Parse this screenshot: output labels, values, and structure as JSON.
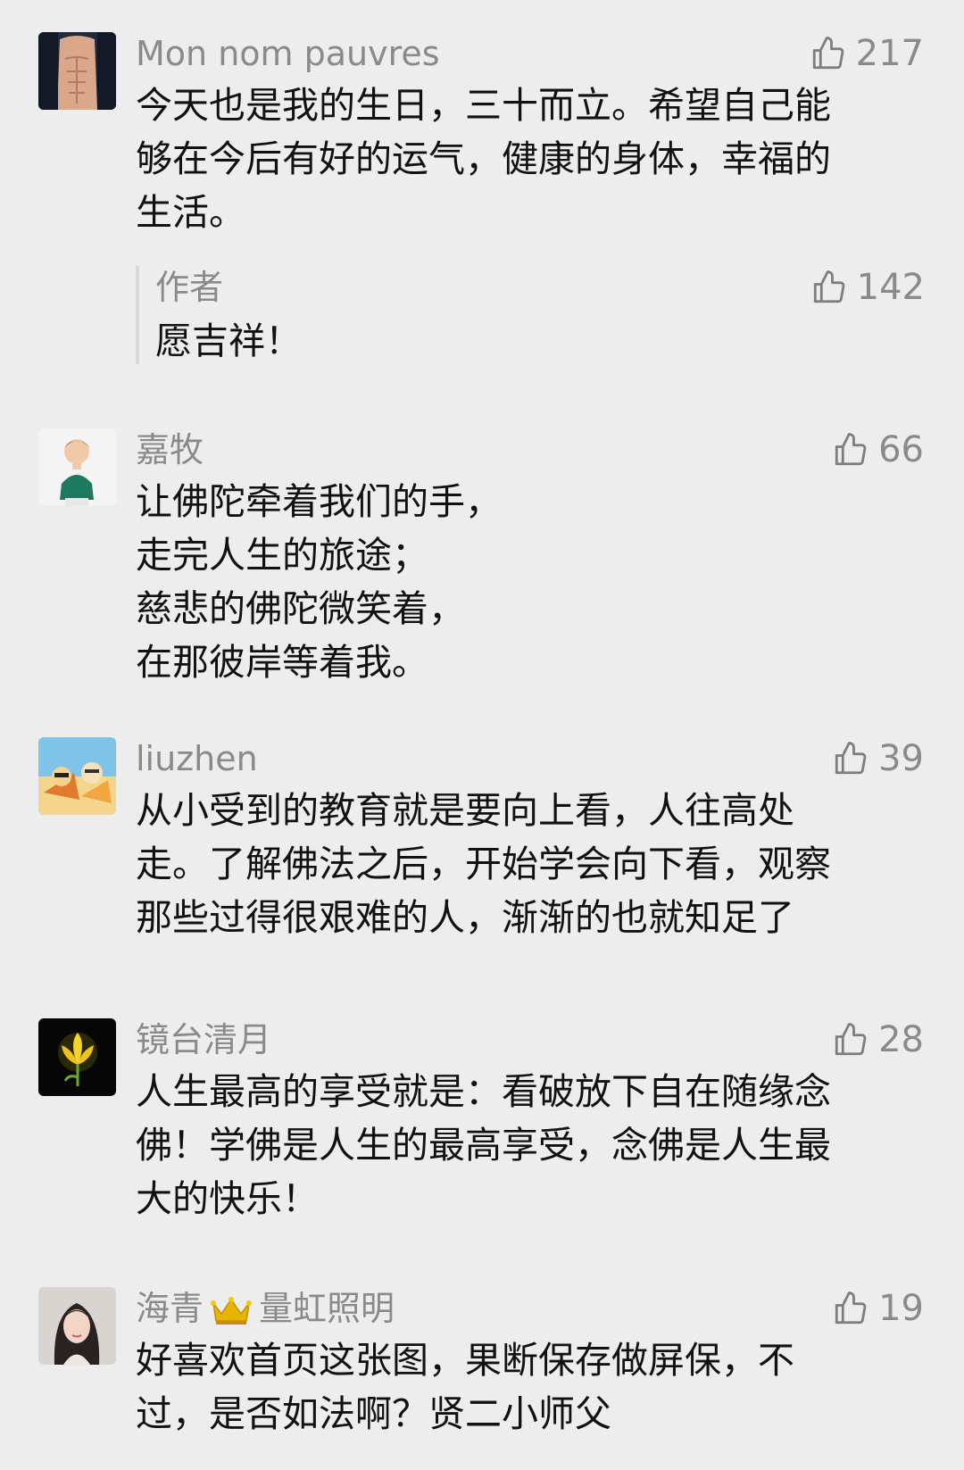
{
  "comments": [
    {
      "name": "Mon nom pauvres",
      "likes": "217",
      "text": "今天也是我的生日，三十而立。希望自己能\n够在今后有好的运气，健康的身体，幸福的\n生活。",
      "reply": {
        "author": "作者",
        "likes": "142",
        "text": "愿吉祥！"
      }
    },
    {
      "name": "嘉牧",
      "likes": "66",
      "text": "让佛陀牵着我们的手，\n走完人生的旅途；\n慈悲的佛陀微笑着，\n在那彼岸等着我。"
    },
    {
      "name": "liuzhen",
      "likes": "39",
      "text": "从小受到的教育就是要向上看，人往高处\n走。了解佛法之后，开始学会向下看，观察\n那些过得很艰难的人，渐渐的也就知足了"
    },
    {
      "name": "镜台清月",
      "likes": "28",
      "text": "人生最高的享受就是：看破放下自在随缘念\n佛！学佛是人生的最高享受，念佛是人生最\n大的快乐！"
    },
    {
      "name": "海青",
      "name_extra": "量虹照明",
      "likes": "19",
      "text": "好喜欢首页这张图，果断保存做屏保，不\n过，是否如法啊？贤二小师父"
    }
  ],
  "icons": {
    "like": "thumbs-up-icon",
    "badge": "crown-icon"
  },
  "colors": {
    "background": "#ededed",
    "name": "#8a8a8a",
    "text": "#111111",
    "reply_bar": "#d8d8d8",
    "crown": "#e8b400"
  }
}
